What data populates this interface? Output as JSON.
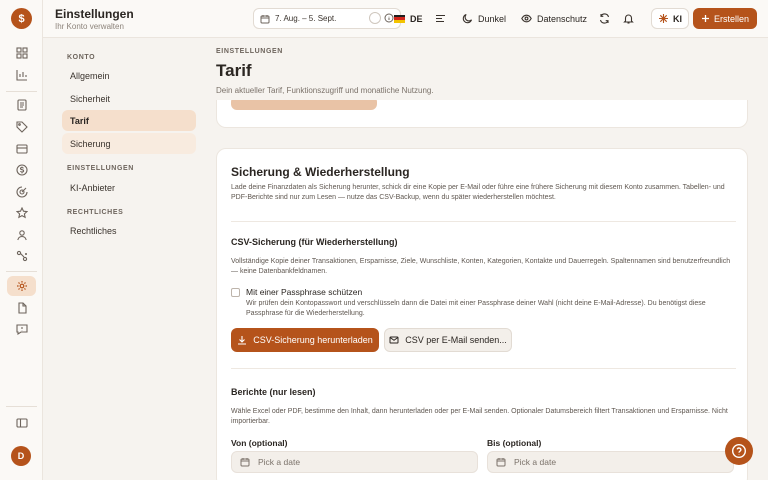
{
  "app": {
    "title": "Einstellungen",
    "subtitle": "Ihr Konto verwalten",
    "logo_glyph": "$",
    "avatar_initial": "D"
  },
  "topbar": {
    "date_range": "7. Aug. – 5. Sept.",
    "language": "DE",
    "theme_label": "Dunkel",
    "privacy_label": "Datenschutz",
    "ki_label": "KI",
    "create_label": "Erstellen"
  },
  "settings_nav": {
    "sections": [
      {
        "label": "KONTO",
        "items": [
          "Allgemein",
          "Sicherheit",
          "Tarif",
          "Sicherung"
        ]
      },
      {
        "label": "EINSTELLUNGEN",
        "items": [
          "KI-Anbieter"
        ]
      },
      {
        "label": "RECHTLICHES",
        "items": [
          "Rechtliches"
        ]
      }
    ],
    "active_item": "Tarif"
  },
  "page": {
    "breadcrumb": "EINSTELLUNGEN",
    "title": "Tarif",
    "description": "Dein aktueller Tarif, Funktionszugriff und monatliche Nutzung."
  },
  "backup_card": {
    "title": "Sicherung & Wiederherstellung",
    "description": "Lade deine Finanzdaten als Sicherung herunter, schick dir eine Kopie per E-Mail oder führe eine frühere Sicherung mit diesem Konto zusammen. Tabellen- und PDF-Berichte sind nur zum Lesen — nutze das CSV-Backup, wenn du später wiederherstellen möchtest.",
    "csv": {
      "title": "CSV-Sicherung (für Wiederherstellung)",
      "description": "Vollständige Kopie deiner Transaktionen, Ersparnisse, Ziele, Wunschliste, Konten, Kategorien, Kontakte und Dauerregeln. Spaltennamen sind benutzerfreundlich — keine Datenbankfeldnamen.",
      "passphrase_label": "Mit einer Passphrase schützen",
      "passphrase_checked": false,
      "passphrase_desc": "Wir prüfen dein Kontopasswort und verschlüsseln dann die Datei mit einer Passphrase deiner Wahl (nicht deine E-Mail-Adresse). Du benötigst diese Passphrase für die Wiederherstellung.",
      "download_label": "CSV-Sicherung herunterladen",
      "email_label": "CSV per E-Mail senden..."
    },
    "reports": {
      "title": "Berichte (nur lesen)",
      "description": "Wähle Excel oder PDF, bestimme den Inhalt, dann herunterladen oder per E-Mail senden. Optionaler Datumsbereich filtert Transaktionen und Ersparnisse. Nicht importierbar.",
      "from_label": "Von (optional)",
      "to_label": "Bis (optional)",
      "from_placeholder": "Pick a date",
      "to_placeholder": "Pick a date"
    }
  },
  "colors": {
    "accent": "#b5531b",
    "active_nav_bg": "#f5dfcc",
    "page_bg": "#f6f3ef"
  }
}
